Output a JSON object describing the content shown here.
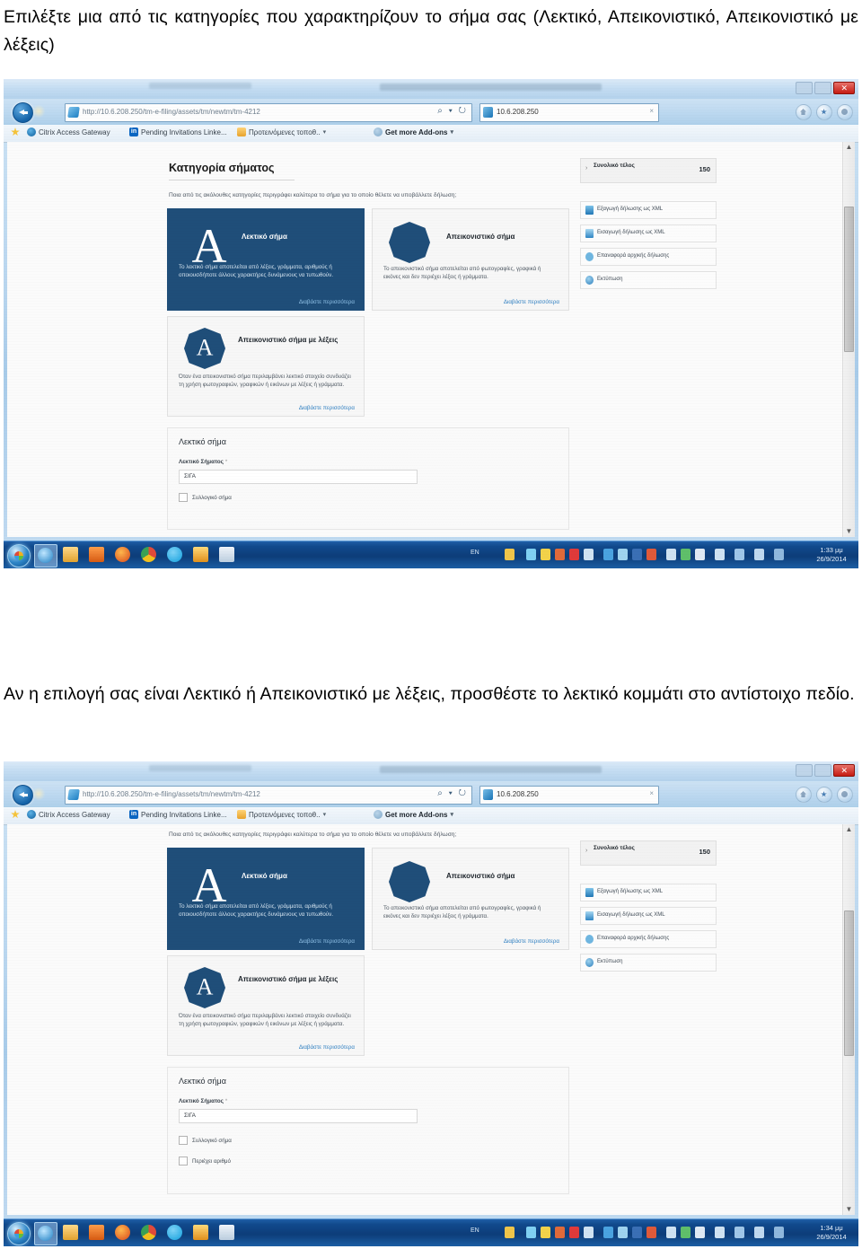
{
  "document": {
    "paragraph_top": "Επιλέξτε μια από τις κατηγορίες που χαρακτηρίζουν το σήμα σας (Λεκτικό, Απεικονιστικό, Απεικονιστικό με λέξεις)",
    "paragraph_middle": "Αν η επιλογή σας είναι Λεκτικό ή Απεικονιστικό με λέξεις, προσθέστε το λεκτικό κομμάτι στο αντίστοιχο πεδίο."
  },
  "colors": {
    "selected_card": "#1f4e79",
    "link": "#2f7fc1",
    "taskbar": "#0d3d79",
    "close_button": "#c61b12"
  },
  "browser": {
    "window_title": "Κατηγορία σήματος - Windows Internet Explorer",
    "window_controls": {
      "minimize": "—",
      "maximize": "□",
      "close": "✕"
    },
    "back_button": "back-arrow",
    "address": {
      "scheme": "http://",
      "host": "10.6.208.250",
      "path": "/tm-e-filing/assets/tm/newtm/tm-4212",
      "full": "http://10.6.208.250/tm-e-filing/assets/tm/newtm/tm-4212",
      "search_tool": "🔍",
      "refresh_tool": "↻"
    },
    "search_box": {
      "value": "10.6.208.250",
      "clear": "×"
    },
    "toolbar_icons": [
      "home-icon",
      "favorites-icon",
      "settings-gear-icon"
    ],
    "favorites": [
      {
        "label": "",
        "icon": "star-icon"
      },
      {
        "label": "Citrix Access Gateway",
        "icon": "citrix-icon"
      },
      {
        "label": "Pending Invitations  Linke...",
        "icon": "linkedin-icon"
      },
      {
        "label": "Προτεινόμενες τοποθ..",
        "icon": "folder-icon"
      },
      {
        "label": "Get more Add-ons",
        "icon": "addons-icon"
      }
    ]
  },
  "page": {
    "title": "Κατηγορία σήματος",
    "intro": "Ποια από τις ακόλουθες κατηγορίες περιγράφει καλύτερα το σήμα για το οποίο θέλετε να υποβάλλετε δήλωση;",
    "cards": [
      {
        "id": "word-mark",
        "icon": "letter-A-icon",
        "icon_glyph": "A",
        "title": "Λεκτικό σήμα",
        "description": "Το λεκτικό σήμα αποτελείται από λέξεις, γράμματα, αριθμούς ή οποιουσδήποτε άλλους χαρακτήρες δυνάμενους να τυπωθούν.",
        "link": "Διαβάστε περισσότερα",
        "selected": true
      },
      {
        "id": "figurative-mark",
        "icon": "polygon-icon",
        "icon_glyph": "",
        "title": "Απεικονιστικό σήμα",
        "description": "Το απεικονιστικό σήμα αποτελείται από φωτογραφίες, γραφικά ή εικόνες και δεν περιέχει λέξεις ή γράμματα.",
        "link": "Διαβάστε περισσότερα",
        "selected": false
      },
      {
        "id": "figurative-with-words",
        "icon": "polygon-letter-A-icon",
        "icon_glyph": "A",
        "title": "Απεικονιστικό σήμα με λέξεις",
        "description": "Όταν ένα απεικονιστικό σήμα περιλαμβάνει λεκτικό στοιχείο συνδυάζει τη χρήση φωτογραφιών, γραφικών ή εικόνων με λέξεις ή γράμματα.",
        "link": "Διαβάστε περισσότερα",
        "selected": false
      }
    ],
    "form": {
      "section_title": "Λεκτικό σήμα",
      "field_label": "Λεκτικό Σήματος",
      "field_required_mark": "*",
      "field_value": "ΣΙΓΑ",
      "checkboxes": [
        {
          "label": "Συλλογικό σήμα",
          "checked": false
        },
        {
          "label": "Περιέχει αριθμό",
          "checked": false
        }
      ]
    },
    "sidebar": {
      "summary": {
        "caret": "›",
        "label": "Συνολικό τέλος",
        "value": "150"
      },
      "actions": [
        {
          "label": "Εξαγωγή δήλωσης ως XML",
          "icon": "export-doc-icon"
        },
        {
          "label": "Εισαγωγή δήλωσης ως XML",
          "icon": "import-doc-icon"
        },
        {
          "label": "Επαναφορά αρχικής δήλωσης",
          "icon": "restore-icon"
        },
        {
          "label": "Εκτύπωση",
          "icon": "print-icon"
        }
      ]
    }
  },
  "taskbar": {
    "start_button": "windows-start-orb",
    "items": [
      "internet-explorer-icon",
      "windows-explorer-icon",
      "media-player-icon",
      "firefox-icon",
      "chrome-icon",
      "skype-icon",
      "outlook-icon",
      "word-document-icon"
    ],
    "language": "EN",
    "clock_1": {
      "time": "1:33 μμ",
      "date": "26/9/2014"
    },
    "clock_2": {
      "time": "1:34 μμ",
      "date": "26/9/2014"
    }
  }
}
